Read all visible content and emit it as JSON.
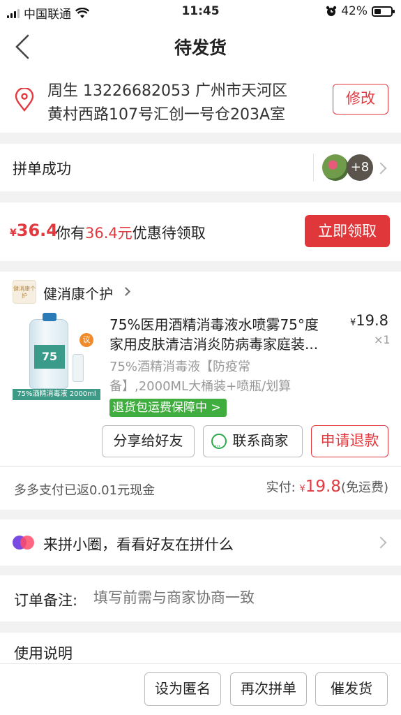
{
  "status_bar": {
    "carrier": "中国联通",
    "time": "11:45",
    "battery": "42%",
    "battery_level": 0.42
  },
  "header": {
    "title": "待发货"
  },
  "address": {
    "line1": "周生  13226682053  广州市天河区",
    "line2": "黄村西路107号汇创一号仓203A室",
    "edit_label": "修改"
  },
  "group_buy": {
    "label": "拼单成功",
    "extra_count": "+8"
  },
  "coupon": {
    "currency": "¥",
    "amount": "36.4",
    "text_prefix": "你有",
    "text_amount": "36.4元",
    "text_suffix": "优惠待领取",
    "claim_label": "立即领取"
  },
  "shop": {
    "logo_text": "健消康个护",
    "name": "健消康个护"
  },
  "product": {
    "title_line1": "75%医用酒精消毒液水喷雾75°度",
    "title_line2": "家用皮肤清洁消炎防病毒家庭装...",
    "currency": "¥",
    "price": "19.8",
    "quantity": "×1",
    "spec_line1": "75%酒精消毒液【防疫常",
    "spec_line2": "备】,2000ML大桶装+喷瓶/划算",
    "image_caption": "75%酒精消毒液 2000ml",
    "image_badge": "议",
    "bottle_label": "75",
    "guarantee": "退货包运费保障中 >"
  },
  "actions": {
    "share": "分享给好友",
    "contact": "联系商家",
    "refund": "申请退款"
  },
  "payment": {
    "cashback": "多多支付已返0.01元现金",
    "paid_label": "实付: ",
    "currency": "¥",
    "paid_amount": "19.8",
    "shipping": "(免运费)"
  },
  "circle": {
    "text": "来拼小圈，看看好友在拼什么"
  },
  "remark": {
    "label": "订单备注:",
    "placeholder": "填写前需与商家协商一致"
  },
  "usage": {
    "label": "使用说明"
  },
  "bottom_bar": {
    "anonymous": "设为匿名",
    "reorder": "再次拼单",
    "urge": "催发货"
  },
  "colors": {
    "accent_red": "#e2393f",
    "guarantee_green": "#3fae3f",
    "background": "#f2f2f2"
  }
}
